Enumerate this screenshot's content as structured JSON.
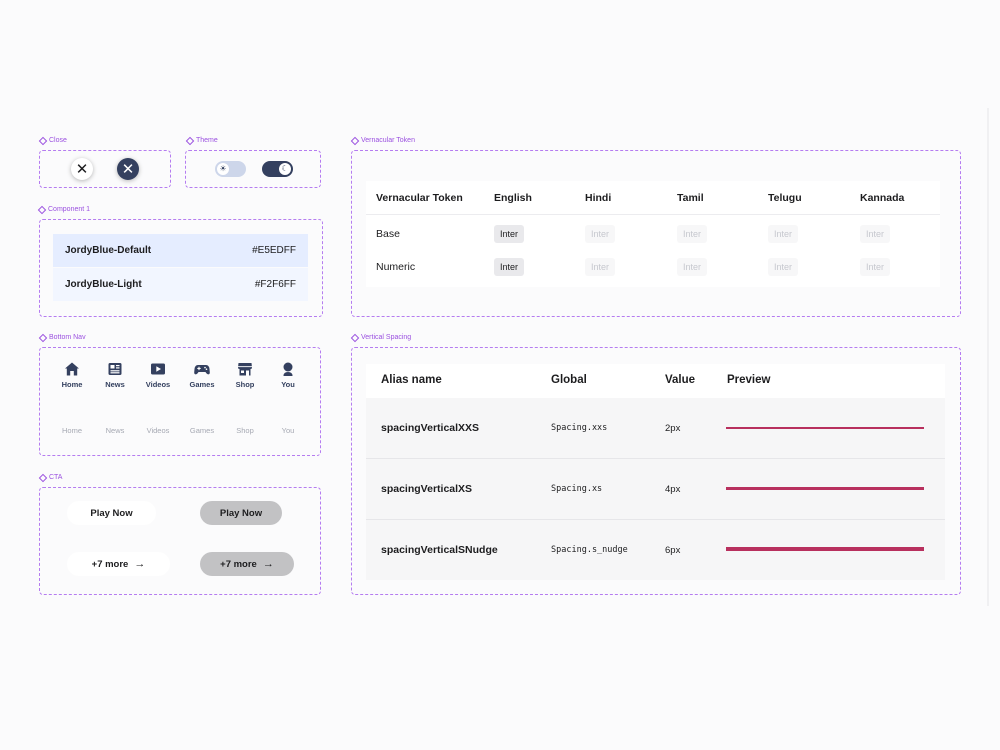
{
  "frames": {
    "close": "Close",
    "theme": "Theme",
    "component1": "Component 1",
    "bottom_nav": "Bottom Nav",
    "cta": "CTA",
    "vernacular": "Vernacular Token",
    "vertical_spacing": "Vertical Spacing"
  },
  "close_buttons": {
    "glyph": "✕",
    "light_bg": "#FFFFFF",
    "dark_bg": "#34405F"
  },
  "theme_toggle": {
    "light_icon": "sun-icon",
    "dark_icon": "moon-icon",
    "sun_glyph": "☀",
    "moon_glyph": "☾"
  },
  "component1": {
    "rows": [
      {
        "name": "JordyBlue-Default",
        "hex": "#E5EDFF",
        "color": "#E5EDFF"
      },
      {
        "name": "JordyBlue-Light",
        "hex": "#F2F6FF",
        "color": "#F2F6FF"
      }
    ]
  },
  "bottom_nav": {
    "active": [
      {
        "label": "Home",
        "icon": "home-icon"
      },
      {
        "label": "News",
        "icon": "news-icon"
      },
      {
        "label": "Videos",
        "icon": "videos-icon"
      },
      {
        "label": "Games",
        "icon": "games-icon"
      },
      {
        "label": "Shop",
        "icon": "shop-icon"
      },
      {
        "label": "You",
        "icon": "user-icon"
      }
    ],
    "muted": [
      "Home",
      "News",
      "Videos",
      "Games",
      "Shop",
      "You"
    ]
  },
  "cta": {
    "play_now": "Play Now",
    "more": "+7 more",
    "arrow": "→"
  },
  "vernacular": {
    "headers": [
      "Vernacular Token",
      "English",
      "Hindi",
      "Tamil",
      "Telugu",
      "Kannada"
    ],
    "rows": [
      {
        "label": "Base",
        "values": [
          "Inter",
          "Inter",
          "Inter",
          "Inter",
          "Inter"
        ]
      },
      {
        "label": "Numeric",
        "values": [
          "Inter",
          "Inter",
          "Inter",
          "Inter",
          "Inter"
        ]
      }
    ]
  },
  "vertical_spacing": {
    "headers": [
      "Alias name",
      "Global",
      "Value",
      "Preview"
    ],
    "rows": [
      {
        "alias": "spacingVerticalXXS",
        "global": "Spacing.xxs",
        "value": "2px"
      },
      {
        "alias": "spacingVerticalXS",
        "global": "Spacing.xs",
        "value": "4px"
      },
      {
        "alias": "spacingVerticalSNudge",
        "global": "Spacing.s_nudge",
        "value": "6px"
      }
    ],
    "preview_color": "#B8305E"
  },
  "colors": {
    "frame_border": "#B57CF0",
    "label_purple": "#9B51E0",
    "navy": "#34405F"
  }
}
